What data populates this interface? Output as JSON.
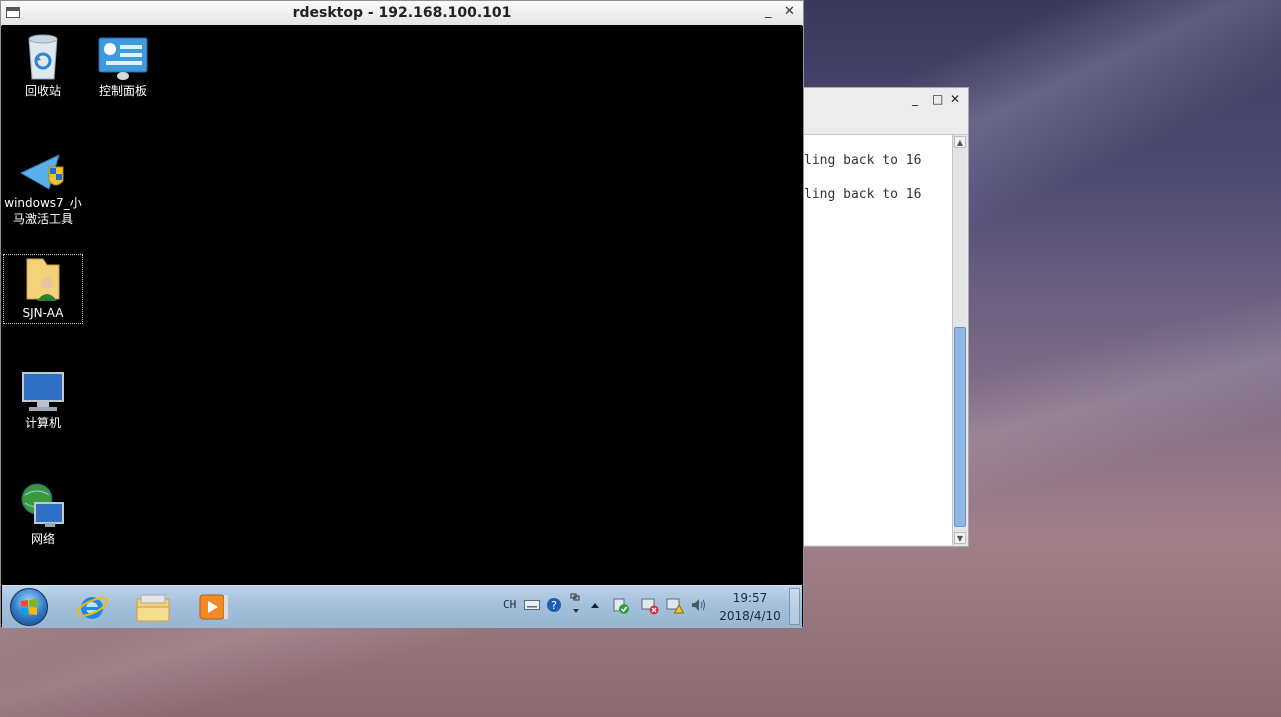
{
  "terminal": {
    "lines": [
      "ling back to 16",
      "ling back to 16"
    ],
    "controls": {
      "minimize": "_",
      "maximize": "□",
      "close": "✕"
    }
  },
  "rdesktop": {
    "title": "rdesktop - 192.168.100.101",
    "controls": {
      "minimize": "_",
      "close": "✕"
    }
  },
  "desktop_icons": [
    {
      "label": "回收站",
      "icon": "recycle-bin-icon"
    },
    {
      "label": "控制面板",
      "icon": "control-panel-icon"
    },
    {
      "label": "windows7_小马激活工具",
      "icon": "activation-tool-icon"
    },
    {
      "label": "SJN-AA",
      "icon": "user-folder-icon"
    },
    {
      "label": "计算机",
      "icon": "computer-icon"
    },
    {
      "label": "网络",
      "icon": "network-icon"
    }
  ],
  "taskbar": {
    "apps": [
      "internet-explorer-icon",
      "file-explorer-icon",
      "media-player-icon"
    ],
    "tray": {
      "input_lang": "CH"
    },
    "clock": {
      "time": "19:57",
      "date": "2018/4/10"
    }
  }
}
